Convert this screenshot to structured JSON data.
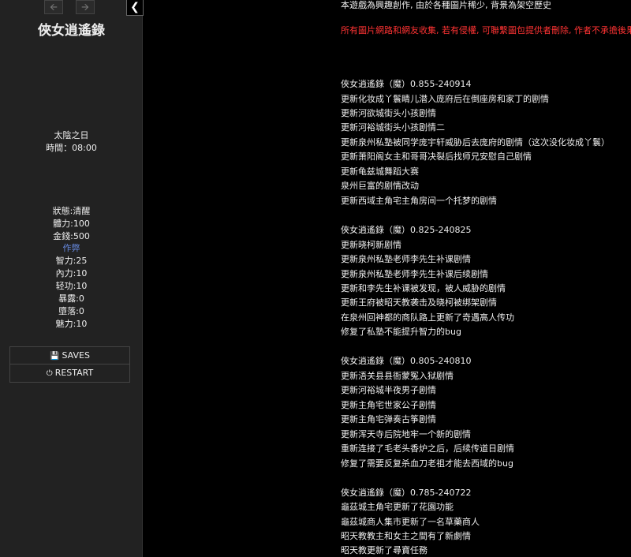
{
  "sidebar": {
    "history_back_icon": "arrow-left-icon",
    "history_forward_icon": "arrow-right-icon",
    "toggle_icon": "chevron-left-icon",
    "title": "俠女逍遙錄",
    "caption": {
      "period": "太陰之日",
      "time": "時間：08:00",
      "status": "狀態:清醒",
      "stamina": "體力:100",
      "money": "金錢:500",
      "cheat": "作弊",
      "intelligence": "智力:25",
      "inner_power": "內力:10",
      "qinggong": "轻功:10",
      "exposure": "暴露:0",
      "degeneracy": "墮落:0",
      "charm": "魅力:10"
    },
    "menu": {
      "saves": "SAVES",
      "restart": "RESTART",
      "saves_icon": "floppy-disk-icon",
      "restart_icon": "power-icon"
    }
  },
  "passage": {
    "intro": "本遊戲為興趣創作, 由於各種圖片稀少, 背景為架空歷史",
    "warning": "所有圖片網路和網友收集, 若有侵權, 可聯繫圖包提供者刪除, 作者不承擔後果",
    "lines": [
      "俠女逍遙錄（魔）0.855-240914",
      "更新化妆成丫鬟睛儿潜入庞府后在倒座房和家丁的剧情",
      "更新河欲城街头小孩剧情",
      "更新河裕城街头小孩剧情二",
      "更新泉州私塾被同学庞宇轩威胁后去庞府的剧情（这次没化妆成丫鬟）",
      "更新萧阳阁女主和哥哥决裂后找师兄安慰自己剧情",
      "更新龟兹城舞蹈大赛",
      "泉州巨富的剧情改动",
      "更新西域主角宅主角房间一个托梦的剧情",
      "俠女逍遙錄（魔）0.825-240825",
      "更新晓柯新剧情",
      "更新泉州私塾老师李先生补课剧情",
      "更新泉州私塾老师李先生补课后续剧情",
      "更新和李先生补课被发现，被人威胁的剧情",
      "更新王府被昭天教袭击及晓柯被绑架剧情",
      "在泉州回神都的商队路上更新了奇遇高人传功",
      "修复了私塾不能提升智力的bug",
      "俠女逍遙錄（魔）0.805-240810",
      "更新浯关县县衙蒙冤入狱剧情",
      "更新河裕城半夜男子剧情",
      "更新主角宅世家公子剧情",
      "更新主角宅弹奏古筝剧情",
      "更新浑天寺后院地牢一个新的剧情",
      "重新连接了毛老头香炉之后，后续传道日剧情",
      "修复了需要反复杀血刀老祖才能去西域的bug",
      "俠女逍遙錄（魔）0.785-240722",
      "龜茲城主角宅更新了花園功能",
      "龜茲城商人集市更新了一名草藥商人",
      "昭天教教主和女主之間有了新劇情",
      "昭天教更新了尋寶任務"
    ]
  }
}
